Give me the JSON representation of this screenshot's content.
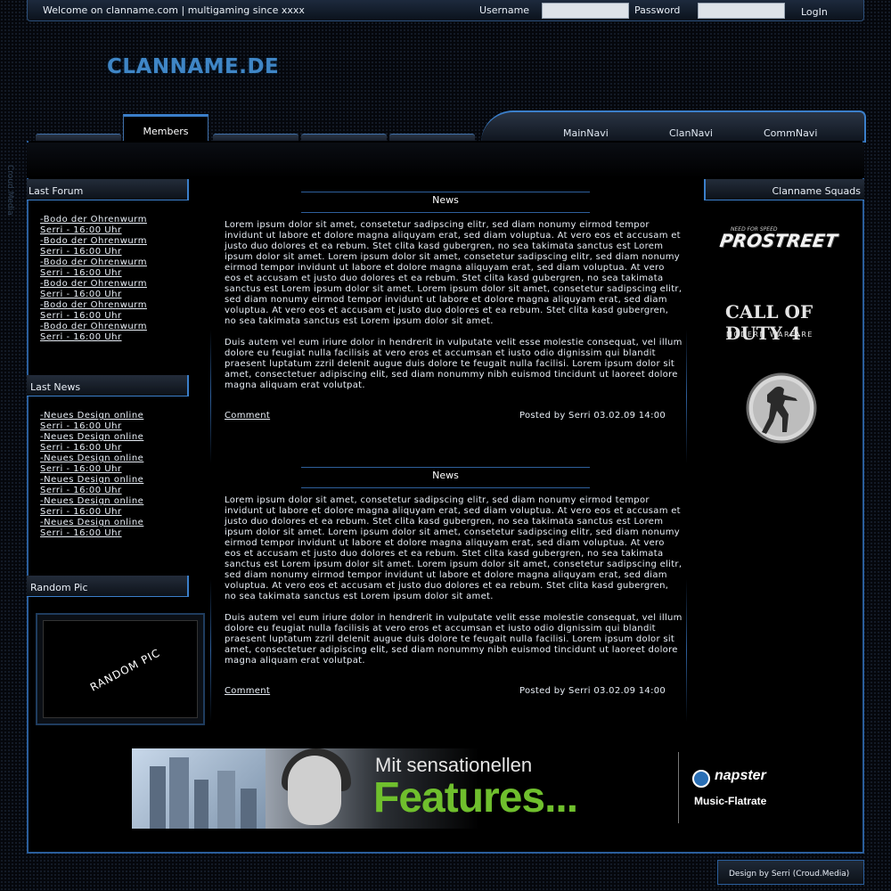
{
  "header": {
    "welcome": "Welcome on clanname.com  | multigaming since xxxx",
    "username_label": "Username",
    "password_label": "Password",
    "login_label": "LogIn"
  },
  "logo": "CLANNAME.DE",
  "side_watermark": "Croud.Media",
  "nav": {
    "active_tab": "Members",
    "right_items": [
      "MainNavi",
      "ClanNavi",
      "CommNavi"
    ]
  },
  "left": {
    "last_forum": {
      "title": "Last Forum",
      "items": [
        "-Bodo der Ohrenwurm",
        "Serri - 16:00 Uhr",
        "-Bodo der Ohrenwurm",
        "Serri - 16:00 Uhr",
        "-Bodo der Ohrenwurm",
        "Serri - 16:00 Uhr",
        "-Bodo der Ohrenwurm",
        "Serri - 16:00 Uhr",
        "-Bodo der Ohrenwurm",
        "Serri - 16:00 Uhr",
        "-Bodo der Ohrenwurm",
        "Serri - 16:00 Uhr"
      ]
    },
    "last_news": {
      "title": "Last News",
      "items": [
        "-Neues Design online",
        "Serri - 16:00 Uhr",
        "-Neues Design online",
        "Serri - 16:00 Uhr",
        "-Neues Design online",
        "Serri - 16:00 Uhr",
        "-Neues Design online",
        "Serri - 16:00 Uhr",
        "-Neues Design online",
        "Serri - 16:00 Uhr",
        "-Neues Design online",
        "Serri - 16:00 Uhr"
      ]
    },
    "random_pic": {
      "title": "Random Pic",
      "image_text": "RANDOM PIC"
    }
  },
  "right": {
    "squads_title": "Clanname Squads",
    "logo_nfs_small": "NEED FOR SPEED",
    "logo_nfs": "PROSTREET",
    "logo_cod": "CALL OF DUTY 4",
    "logo_cod_sub": "MODERN WARFARE"
  },
  "news": [
    {
      "title": "News",
      "para1": "Lorem ipsum dolor sit amet, consetetur sadipscing elitr, sed diam nonumy eirmod tempor invidunt ut labore et dolore magna aliquyam erat, sed diam voluptua. At vero eos et accusam et justo duo dolores et ea rebum. Stet clita kasd gubergren, no sea takimata sanctus est Lorem ipsum dolor sit amet. Lorem ipsum dolor sit amet, consetetur sadipscing elitr, sed diam nonumy eirmod tempor invidunt ut labore et dolore magna aliquyam erat, sed diam voluptua. At vero eos et accusam et justo duo dolores et ea rebum. Stet clita kasd gubergren, no sea takimata sanctus est Lorem ipsum dolor sit amet. Lorem ipsum dolor sit amet, consetetur sadipscing elitr, sed diam nonumy eirmod tempor invidunt ut labore et dolore magna aliquyam erat, sed diam voluptua. At vero eos et accusam et justo duo dolores et ea rebum. Stet clita kasd gubergren, no sea takimata sanctus est Lorem ipsum dolor sit amet.",
      "para2": "Duis autem vel eum iriure dolor in hendrerit in vulputate velit esse molestie consequat, vel illum dolore eu feugiat nulla facilisis at vero eros et accumsan et iusto odio dignissim qui blandit praesent luptatum zzril delenit augue duis dolore te feugait nulla facilisi. Lorem ipsum dolor sit amet, consectetuer adipiscing elit, sed diam nonummy nibh euismod tincidunt ut laoreet dolore magna aliquam erat volutpat.",
      "comment": "Comment",
      "posted": "Posted by Serri 03.02.09 14:00"
    },
    {
      "title": "News",
      "para1": "Lorem ipsum dolor sit amet, consetetur sadipscing elitr, sed diam nonumy eirmod tempor invidunt ut labore et dolore magna aliquyam erat, sed diam voluptua. At vero eos et accusam et justo duo dolores et ea rebum. Stet clita kasd gubergren, no sea takimata sanctus est Lorem ipsum dolor sit amet. Lorem ipsum dolor sit amet, consetetur sadipscing elitr, sed diam nonumy eirmod tempor invidunt ut labore et dolore magna aliquyam erat, sed diam voluptua. At vero eos et accusam et justo duo dolores et ea rebum. Stet clita kasd gubergren, no sea takimata sanctus est Lorem ipsum dolor sit amet. Lorem ipsum dolor sit amet, consetetur sadipscing elitr, sed diam nonumy eirmod tempor invidunt ut labore et dolore magna aliquyam erat, sed diam voluptua. At vero eos et accusam et justo duo dolores et ea rebum. Stet clita kasd gubergren, no sea takimata sanctus est Lorem ipsum dolor sit amet.",
      "para2": "Duis autem vel eum iriure dolor in hendrerit in vulputate velit esse molestie consequat, vel illum dolore eu feugiat nulla facilisis at vero eros et accumsan et iusto odio dignissim qui blandit praesent luptatum zzril delenit augue duis dolore te feugait nulla facilisi. Lorem ipsum dolor sit amet, consectetuer adipiscing elit, sed diam nonummy nibh euismod tincidunt ut laoreet dolore magna aliquam erat volutpat.",
      "comment": "Comment",
      "posted": "Posted by Serri 03.02.09 14:00"
    }
  ],
  "banner": {
    "line1": "Mit sensationellen",
    "line2": "Features...",
    "brand": "napster",
    "tagline": "Music-Flatrate"
  },
  "footer": "Design by Serri (Croud.Media)",
  "colors": {
    "accent": "#3b7fca",
    "logo": "#3f86c6",
    "banner_green": "#6fbf2d"
  }
}
